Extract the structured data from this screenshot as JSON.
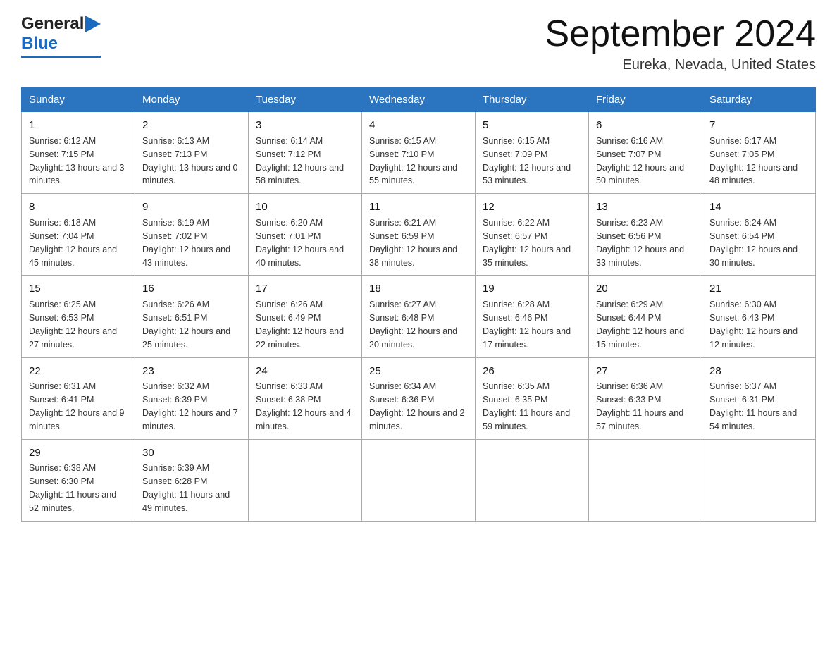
{
  "logo": {
    "general": "General",
    "blue": "Blue"
  },
  "title": "September 2024",
  "location": "Eureka, Nevada, United States",
  "days_of_week": [
    "Sunday",
    "Monday",
    "Tuesday",
    "Wednesday",
    "Thursday",
    "Friday",
    "Saturday"
  ],
  "weeks": [
    [
      {
        "day": "1",
        "sunrise": "Sunrise: 6:12 AM",
        "sunset": "Sunset: 7:15 PM",
        "daylight": "Daylight: 13 hours and 3 minutes."
      },
      {
        "day": "2",
        "sunrise": "Sunrise: 6:13 AM",
        "sunset": "Sunset: 7:13 PM",
        "daylight": "Daylight: 13 hours and 0 minutes."
      },
      {
        "day": "3",
        "sunrise": "Sunrise: 6:14 AM",
        "sunset": "Sunset: 7:12 PM",
        "daylight": "Daylight: 12 hours and 58 minutes."
      },
      {
        "day": "4",
        "sunrise": "Sunrise: 6:15 AM",
        "sunset": "Sunset: 7:10 PM",
        "daylight": "Daylight: 12 hours and 55 minutes."
      },
      {
        "day": "5",
        "sunrise": "Sunrise: 6:15 AM",
        "sunset": "Sunset: 7:09 PM",
        "daylight": "Daylight: 12 hours and 53 minutes."
      },
      {
        "day": "6",
        "sunrise": "Sunrise: 6:16 AM",
        "sunset": "Sunset: 7:07 PM",
        "daylight": "Daylight: 12 hours and 50 minutes."
      },
      {
        "day": "7",
        "sunrise": "Sunrise: 6:17 AM",
        "sunset": "Sunset: 7:05 PM",
        "daylight": "Daylight: 12 hours and 48 minutes."
      }
    ],
    [
      {
        "day": "8",
        "sunrise": "Sunrise: 6:18 AM",
        "sunset": "Sunset: 7:04 PM",
        "daylight": "Daylight: 12 hours and 45 minutes."
      },
      {
        "day": "9",
        "sunrise": "Sunrise: 6:19 AM",
        "sunset": "Sunset: 7:02 PM",
        "daylight": "Daylight: 12 hours and 43 minutes."
      },
      {
        "day": "10",
        "sunrise": "Sunrise: 6:20 AM",
        "sunset": "Sunset: 7:01 PM",
        "daylight": "Daylight: 12 hours and 40 minutes."
      },
      {
        "day": "11",
        "sunrise": "Sunrise: 6:21 AM",
        "sunset": "Sunset: 6:59 PM",
        "daylight": "Daylight: 12 hours and 38 minutes."
      },
      {
        "day": "12",
        "sunrise": "Sunrise: 6:22 AM",
        "sunset": "Sunset: 6:57 PM",
        "daylight": "Daylight: 12 hours and 35 minutes."
      },
      {
        "day": "13",
        "sunrise": "Sunrise: 6:23 AM",
        "sunset": "Sunset: 6:56 PM",
        "daylight": "Daylight: 12 hours and 33 minutes."
      },
      {
        "day": "14",
        "sunrise": "Sunrise: 6:24 AM",
        "sunset": "Sunset: 6:54 PM",
        "daylight": "Daylight: 12 hours and 30 minutes."
      }
    ],
    [
      {
        "day": "15",
        "sunrise": "Sunrise: 6:25 AM",
        "sunset": "Sunset: 6:53 PM",
        "daylight": "Daylight: 12 hours and 27 minutes."
      },
      {
        "day": "16",
        "sunrise": "Sunrise: 6:26 AM",
        "sunset": "Sunset: 6:51 PM",
        "daylight": "Daylight: 12 hours and 25 minutes."
      },
      {
        "day": "17",
        "sunrise": "Sunrise: 6:26 AM",
        "sunset": "Sunset: 6:49 PM",
        "daylight": "Daylight: 12 hours and 22 minutes."
      },
      {
        "day": "18",
        "sunrise": "Sunrise: 6:27 AM",
        "sunset": "Sunset: 6:48 PM",
        "daylight": "Daylight: 12 hours and 20 minutes."
      },
      {
        "day": "19",
        "sunrise": "Sunrise: 6:28 AM",
        "sunset": "Sunset: 6:46 PM",
        "daylight": "Daylight: 12 hours and 17 minutes."
      },
      {
        "day": "20",
        "sunrise": "Sunrise: 6:29 AM",
        "sunset": "Sunset: 6:44 PM",
        "daylight": "Daylight: 12 hours and 15 minutes."
      },
      {
        "day": "21",
        "sunrise": "Sunrise: 6:30 AM",
        "sunset": "Sunset: 6:43 PM",
        "daylight": "Daylight: 12 hours and 12 minutes."
      }
    ],
    [
      {
        "day": "22",
        "sunrise": "Sunrise: 6:31 AM",
        "sunset": "Sunset: 6:41 PM",
        "daylight": "Daylight: 12 hours and 9 minutes."
      },
      {
        "day": "23",
        "sunrise": "Sunrise: 6:32 AM",
        "sunset": "Sunset: 6:39 PM",
        "daylight": "Daylight: 12 hours and 7 minutes."
      },
      {
        "day": "24",
        "sunrise": "Sunrise: 6:33 AM",
        "sunset": "Sunset: 6:38 PM",
        "daylight": "Daylight: 12 hours and 4 minutes."
      },
      {
        "day": "25",
        "sunrise": "Sunrise: 6:34 AM",
        "sunset": "Sunset: 6:36 PM",
        "daylight": "Daylight: 12 hours and 2 minutes."
      },
      {
        "day": "26",
        "sunrise": "Sunrise: 6:35 AM",
        "sunset": "Sunset: 6:35 PM",
        "daylight": "Daylight: 11 hours and 59 minutes."
      },
      {
        "day": "27",
        "sunrise": "Sunrise: 6:36 AM",
        "sunset": "Sunset: 6:33 PM",
        "daylight": "Daylight: 11 hours and 57 minutes."
      },
      {
        "day": "28",
        "sunrise": "Sunrise: 6:37 AM",
        "sunset": "Sunset: 6:31 PM",
        "daylight": "Daylight: 11 hours and 54 minutes."
      }
    ],
    [
      {
        "day": "29",
        "sunrise": "Sunrise: 6:38 AM",
        "sunset": "Sunset: 6:30 PM",
        "daylight": "Daylight: 11 hours and 52 minutes."
      },
      {
        "day": "30",
        "sunrise": "Sunrise: 6:39 AM",
        "sunset": "Sunset: 6:28 PM",
        "daylight": "Daylight: 11 hours and 49 minutes."
      },
      {
        "day": "",
        "sunrise": "",
        "sunset": "",
        "daylight": ""
      },
      {
        "day": "",
        "sunrise": "",
        "sunset": "",
        "daylight": ""
      },
      {
        "day": "",
        "sunrise": "",
        "sunset": "",
        "daylight": ""
      },
      {
        "day": "",
        "sunrise": "",
        "sunset": "",
        "daylight": ""
      },
      {
        "day": "",
        "sunrise": "",
        "sunset": "",
        "daylight": ""
      }
    ]
  ]
}
